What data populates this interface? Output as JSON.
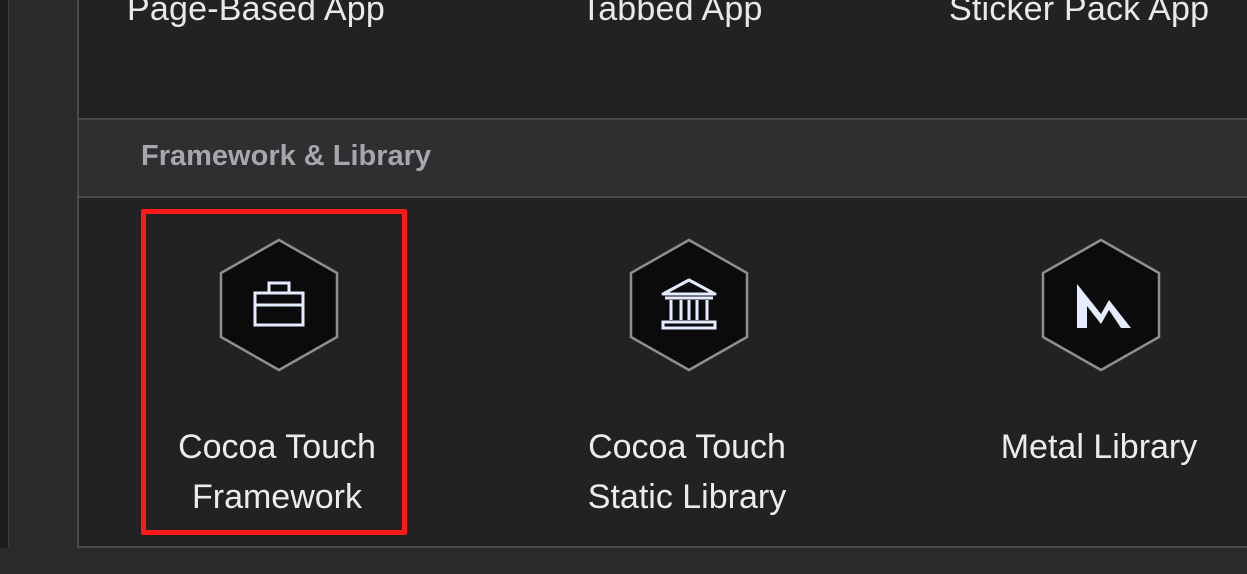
{
  "templates_row": {
    "items": [
      {
        "label": "Page-Based App"
      },
      {
        "label": "Tabbed App"
      },
      {
        "label": "Sticker Pack App"
      }
    ]
  },
  "section": {
    "title": "Framework & Library"
  },
  "items": [
    {
      "icon": "toolbox-icon",
      "label_line1": "Cocoa Touch",
      "label_line2": "Framework",
      "selected": true
    },
    {
      "icon": "library-building-icon",
      "label_line1": "Cocoa Touch",
      "label_line2": "Static Library",
      "selected": false
    },
    {
      "icon": "metal-icon",
      "label_line1": "Metal Library",
      "label_line2": "",
      "selected": false
    }
  ],
  "colors": {
    "background": "#222224",
    "section_header": "#2f2f32",
    "highlight": "#ff1a1a",
    "icon_fill": "#0b0b0c",
    "icon_stroke": "#8e8e93",
    "glyph": "#e6ecff"
  }
}
